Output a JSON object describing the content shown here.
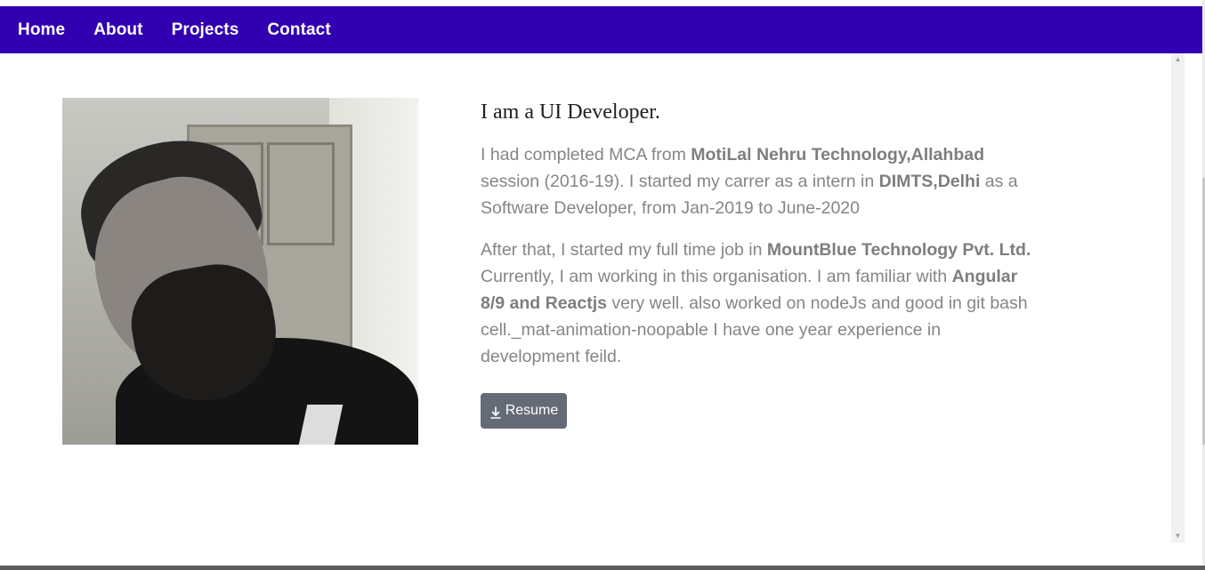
{
  "nav": {
    "items": [
      {
        "label": "Home"
      },
      {
        "label": "About"
      },
      {
        "label": "Projects"
      },
      {
        "label": "Contact"
      }
    ]
  },
  "about": {
    "heading": "I am a UI Developer.",
    "para1": {
      "t1": "I had completed MCA from ",
      "b1": "MotiLal Nehru Technology,Allahbad",
      "t2": " session (2016-19). I started my carrer as a intern in ",
      "b2": "DIMTS,Delhi",
      "t3": " as a Software Developer, from Jan-2019 to June-2020"
    },
    "para2": {
      "t1": "After that, I started my full time job in ",
      "b1": "MountBlue Technology Pvt. Ltd.",
      "t2": " Currently, I am working in this organisation. I am familiar with ",
      "b2": "Angular 8/9 and Reactjs",
      "t3": " very well. also worked on nodeJs and good in git bash cell._mat-animation-noopable I have one year experience in development feild."
    },
    "resume_label": "Resume"
  },
  "colors": {
    "navbar": "#3100b0",
    "button": "#656b76",
    "body_text": "#858585"
  },
  "icons": {
    "resume": "download-icon"
  }
}
